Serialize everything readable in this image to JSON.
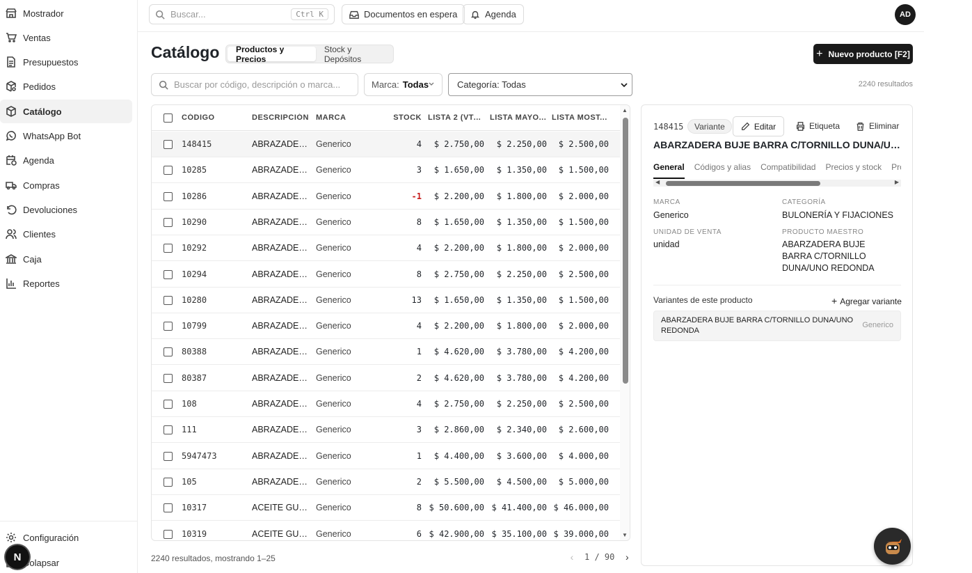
{
  "sidebar": {
    "items": [
      {
        "label": "Mostrador",
        "icon": "store-icon"
      },
      {
        "label": "Ventas",
        "icon": "cart-icon"
      },
      {
        "label": "Presupuestos",
        "icon": "document-icon"
      },
      {
        "label": "Pedidos",
        "icon": "package-search-icon"
      },
      {
        "label": "Catálogo",
        "icon": "box-icon",
        "active": true
      },
      {
        "label": "WhatsApp Bot",
        "icon": "whatsapp-icon"
      },
      {
        "label": "Agenda",
        "icon": "calendar-clock-icon"
      },
      {
        "label": "Compras",
        "icon": "truck-icon"
      },
      {
        "label": "Devoluciones",
        "icon": "undo-icon"
      },
      {
        "label": "Clientes",
        "icon": "users-icon"
      },
      {
        "label": "Caja",
        "icon": "bank-icon"
      },
      {
        "label": "Reportes",
        "icon": "bar-chart-icon"
      }
    ],
    "settings_label": "Configuración",
    "collapse_label": "Colapsar",
    "badge_letter": "N"
  },
  "topbar": {
    "search_placeholder": "Buscar...",
    "shortcut": "Ctrl K",
    "docs_button": "Documentos en espera",
    "agenda_button": "Agenda",
    "user_initials": "AD"
  },
  "page": {
    "title": "Catálogo",
    "tabs": [
      {
        "label": "Productos y Precios",
        "active": true
      },
      {
        "label": "Stock y Depósitos",
        "active": false
      }
    ],
    "new_button": "Nuevo producto [F2]"
  },
  "filters": {
    "search_placeholder": "Buscar por código, descripción o marca...",
    "brand_label": "Marca:",
    "brand_value": "Todas",
    "category_value": "Categoría: Todas",
    "results": "2240 resultados"
  },
  "table": {
    "columns": [
      "CÓDIGO",
      "DESCRIPCIÓN",
      "MARCA",
      "STOCK",
      "LISTA 2 (VTA...",
      "LISTA MAYO...",
      "LISTA MOST..."
    ],
    "rows": [
      {
        "code": "148415",
        "desc": "ABRAZADER...",
        "brand": "Generico",
        "stock": "4",
        "p2": "$ 2.750,00",
        "pm": "$ 2.250,00",
        "pmo": "$ 2.500,00",
        "selected": true
      },
      {
        "code": "10285",
        "desc": "ABRAZADER...",
        "brand": "Generico",
        "stock": "3",
        "p2": "$ 1.650,00",
        "pm": "$ 1.350,00",
        "pmo": "$ 1.500,00"
      },
      {
        "code": "10286",
        "desc": "ABRAZADER...",
        "brand": "Generico",
        "stock": "-1",
        "p2": "$ 2.200,00",
        "pm": "$ 1.800,00",
        "pmo": "$ 2.000,00",
        "negative": true
      },
      {
        "code": "10290",
        "desc": "ABRAZADER...",
        "brand": "Generico",
        "stock": "8",
        "p2": "$ 1.650,00",
        "pm": "$ 1.350,00",
        "pmo": "$ 1.500,00"
      },
      {
        "code": "10292",
        "desc": "ABRAZADER...",
        "brand": "Generico",
        "stock": "4",
        "p2": "$ 2.200,00",
        "pm": "$ 1.800,00",
        "pmo": "$ 2.000,00"
      },
      {
        "code": "10294",
        "desc": "ABRAZADER...",
        "brand": "Generico",
        "stock": "8",
        "p2": "$ 2.750,00",
        "pm": "$ 2.250,00",
        "pmo": "$ 2.500,00"
      },
      {
        "code": "10280",
        "desc": "ABRAZADER...",
        "brand": "Generico",
        "stock": "13",
        "p2": "$ 1.650,00",
        "pm": "$ 1.350,00",
        "pmo": "$ 1.500,00"
      },
      {
        "code": "10799",
        "desc": "ABRAZADER...",
        "brand": "Generico",
        "stock": "4",
        "p2": "$ 2.200,00",
        "pm": "$ 1.800,00",
        "pmo": "$ 2.000,00"
      },
      {
        "code": "80388",
        "desc": "ABRAZADER...",
        "brand": "Generico",
        "stock": "1",
        "p2": "$ 4.620,00",
        "pm": "$ 3.780,00",
        "pmo": "$ 4.200,00"
      },
      {
        "code": "80387",
        "desc": "ABRAZADER...",
        "brand": "Generico",
        "stock": "2",
        "p2": "$ 4.620,00",
        "pm": "$ 3.780,00",
        "pmo": "$ 4.200,00"
      },
      {
        "code": "108",
        "desc": "ABRAZADER...",
        "brand": "Generico",
        "stock": "4",
        "p2": "$ 2.750,00",
        "pm": "$ 2.250,00",
        "pmo": "$ 2.500,00"
      },
      {
        "code": "111",
        "desc": "ABRAZADER...",
        "brand": "Generico",
        "stock": "3",
        "p2": "$ 2.860,00",
        "pm": "$ 2.340,00",
        "pmo": "$ 2.600,00"
      },
      {
        "code": "5947473",
        "desc": "ABRAZADER...",
        "brand": "Generico",
        "stock": "1",
        "p2": "$ 4.400,00",
        "pm": "$ 3.600,00",
        "pmo": "$ 4.000,00"
      },
      {
        "code": "105",
        "desc": "ABRAZADER...",
        "brand": "Generico",
        "stock": "2",
        "p2": "$ 5.500,00",
        "pm": "$ 4.500,00",
        "pmo": "$ 5.000,00"
      },
      {
        "code": "10317",
        "desc": "ACEITE GULF...",
        "brand": "Generico",
        "stock": "8",
        "p2": "$ 50.600,00",
        "pm": "$ 41.400,00",
        "pmo": "$ 46.000,00"
      },
      {
        "code": "10319",
        "desc": "ACEITE GULF...",
        "brand": "Generico",
        "stock": "6",
        "p2": "$ 42.900,00",
        "pm": "$ 35.100,00",
        "pmo": "$ 39.000,00"
      }
    ]
  },
  "footer": {
    "info": "2240 resultados, mostrando 1–25",
    "page": "1 / 90"
  },
  "detail": {
    "code": "148415",
    "badge": "Variante",
    "edit": "Editar",
    "label": "Etiqueta",
    "delete": "Eliminar",
    "title": "ABARZADERA BUJE BARRA C/TORNILLO DUNA/UNO REDONDA",
    "tabs": [
      "General",
      "Códigos y alias",
      "Compatibilidad",
      "Precios y stock",
      "Pro"
    ],
    "brand_label": "MARCA",
    "brand_value": "Generico",
    "category_label": "CATEGORÍA",
    "category_value": "BULONERÍA Y FIJACIONES",
    "unit_label": "UNIDAD DE VENTA",
    "unit_value": "unidad",
    "master_label": "PRODUCTO MAESTRO",
    "master_value": "ABARZADERA BUJE BARRA C/TORNILLO DUNA/UNO REDONDA",
    "variants_title": "Variantes de este producto",
    "add_variant": "Agregar variante",
    "variant_name": "ABARZADERA BUJE BARRA C/TORNILLO DUNA/UNO REDONDA",
    "variant_brand": "Generico"
  }
}
